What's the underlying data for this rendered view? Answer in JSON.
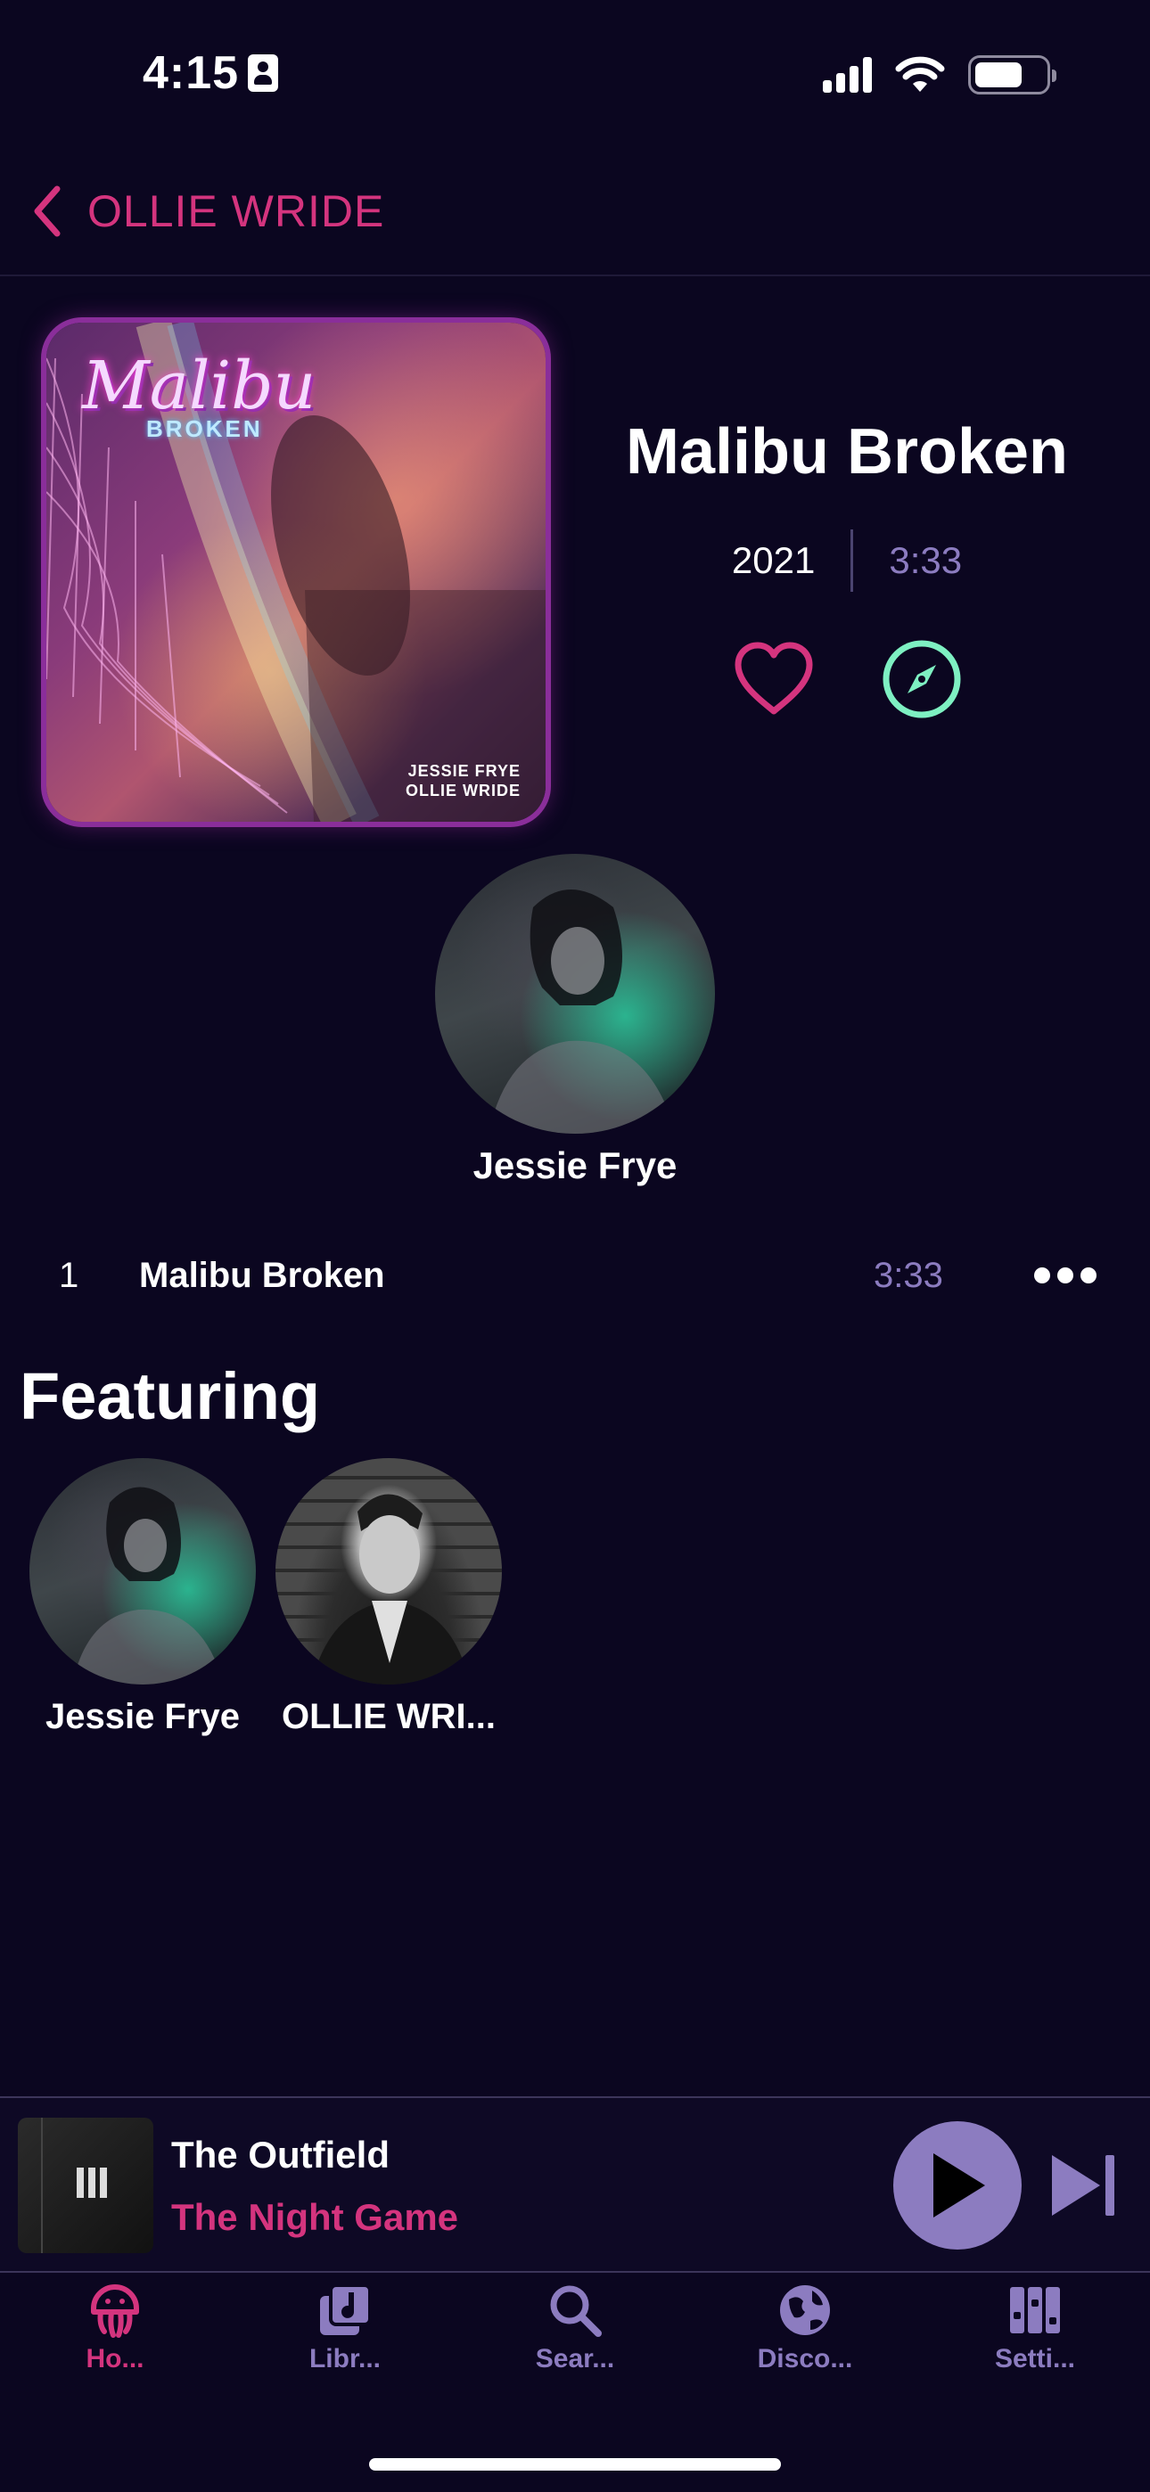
{
  "status_bar": {
    "time": "4:15",
    "icons": [
      "id-badge-icon",
      "signal-icon",
      "wifi-icon",
      "battery-icon"
    ],
    "battery_level": 0.65
  },
  "header": {
    "back_label": "OLLIE WRIDE"
  },
  "album": {
    "art_title": "Malibu",
    "art_subtitle": "BROKEN",
    "art_credits": [
      "JESSIE FRYE",
      "OLLIE WRIDE"
    ],
    "title": "Malibu Broken",
    "year": "2021",
    "duration": "3:33"
  },
  "main_artist": {
    "name": "Jessie Frye"
  },
  "tracks": [
    {
      "number": "1",
      "title": "Malibu Broken",
      "duration": "3:33"
    }
  ],
  "featuring": {
    "heading": "Featuring",
    "artists": [
      {
        "name": "Jessie Frye"
      },
      {
        "name": "OLLIE WRI..."
      }
    ]
  },
  "player": {
    "artist": "The Outfield",
    "track": "The Night Game"
  },
  "tabs": [
    {
      "label": "Ho...",
      "icon": "jellyfish-home-icon",
      "active": true
    },
    {
      "label": "Libr...",
      "icon": "library-icon",
      "active": false
    },
    {
      "label": "Sear...",
      "icon": "search-icon",
      "active": false
    },
    {
      "label": "Disco...",
      "icon": "globe-icon",
      "active": false
    },
    {
      "label": "Setti...",
      "icon": "settings-icon",
      "active": false
    }
  ],
  "colors": {
    "background": "#0b0620",
    "accent_pink": "#d4347e",
    "accent_purple": "#8c7cc0",
    "accent_mint": "#7ef0c2"
  }
}
